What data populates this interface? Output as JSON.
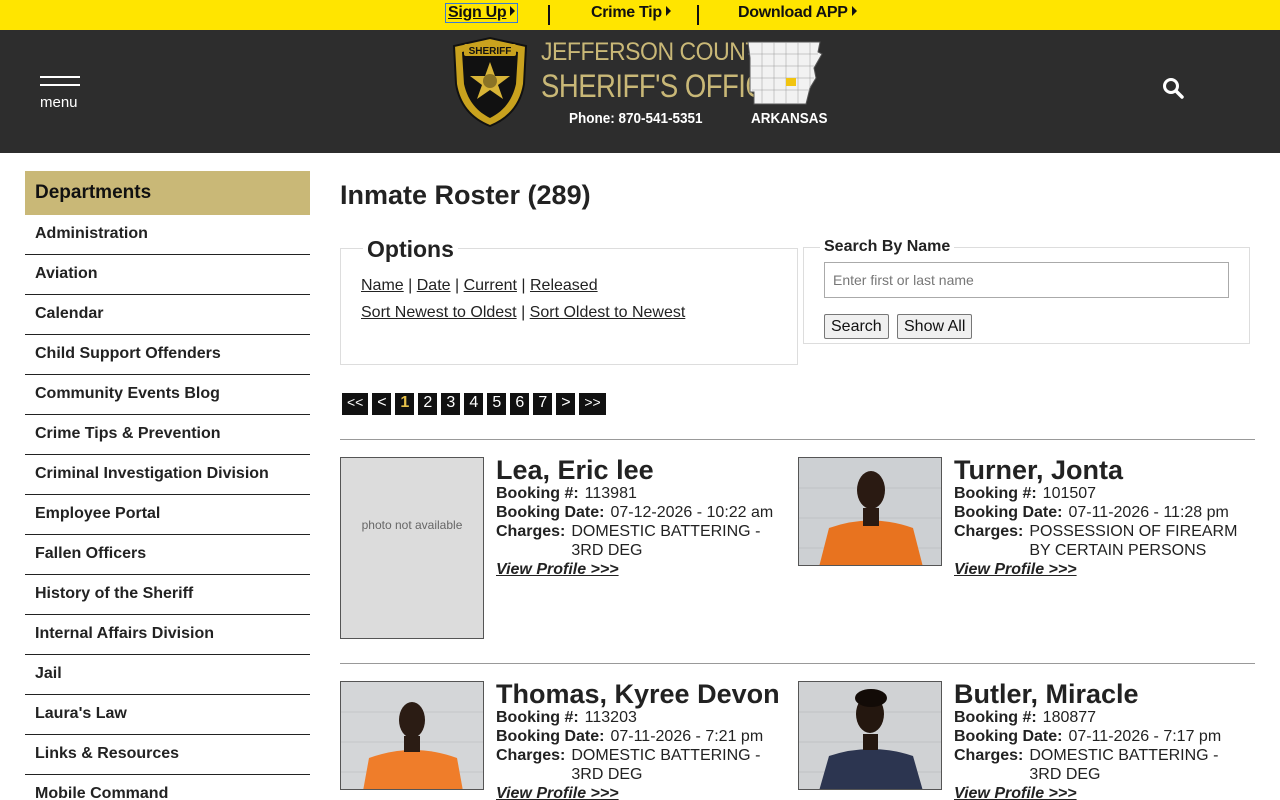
{
  "topbar": {
    "signup": "Sign Up",
    "crime_tip": "Crime Tip",
    "download_app": "Download APP"
  },
  "header": {
    "menu_label": "menu",
    "title_line1": "JEFFERSON COUNTY",
    "title_line2": "SHERIFF'S OFFICE",
    "phone": "Phone: 870-541-5351",
    "state": "ARKANSAS",
    "badge_text": "SHERIFF",
    "brand_gold": "#c9b877",
    "header_bg": "#2d2d2d",
    "topbar_bg": "#ffe500"
  },
  "sidebar": {
    "heading": "Departments",
    "items": [
      "Administration",
      "Aviation",
      "Calendar",
      "Child Support Offenders",
      "Community Events Blog",
      "Crime Tips & Prevention",
      "Criminal Investigation Division",
      "Employee Portal",
      "Fallen Officers",
      "History of the Sheriff",
      "Internal Affairs Division",
      "Jail",
      "Laura's Law",
      "Links & Resources",
      "Mobile Command"
    ]
  },
  "main": {
    "title": "Inmate Roster (289)",
    "options": {
      "legend": "Options",
      "sort_name": "Name",
      "sort_date": "Date",
      "filter_current": "Current",
      "filter_released": "Released",
      "sort_newest": "Sort Newest to Oldest",
      "sort_oldest": "Sort Oldest to Newest"
    },
    "search": {
      "legend": "Search By Name",
      "placeholder": "Enter first or last name",
      "search_label": "Search",
      "show_all_label": "Show All"
    },
    "pager": [
      "<<",
      "<",
      "1",
      "2",
      "3",
      "4",
      "5",
      "6",
      "7",
      ">",
      ">>"
    ],
    "current_page": "1",
    "labels": {
      "booking_no": "Booking #:",
      "booking_date": "Booking Date:",
      "charges": "Charges:",
      "view_profile": "View Profile >>>",
      "photo_na": "photo not available"
    },
    "inmates": [
      {
        "name": "Lea, Eric lee",
        "booking_no": "113981",
        "booking_date": "07-12-2026 - 10:22 am",
        "charges": "DOMESTIC BATTERING - 3RD DEG",
        "photo": "none"
      },
      {
        "name": "Turner, Jonta",
        "booking_no": "101507",
        "booking_date": "07-11-2026 - 11:28 pm",
        "charges": "POSSESSION OF FIREARM BY CERTAIN PERSONS",
        "photo": "orange"
      },
      {
        "name": "Thomas, Kyree Devon",
        "booking_no": "113203",
        "booking_date": "07-11-2026 - 7:21 pm",
        "charges": "DOMESTIC BATTERING - 3RD DEG",
        "photo": "orange"
      },
      {
        "name": "Butler, Miracle",
        "booking_no": "180877",
        "booking_date": "07-11-2026 - 7:17 pm",
        "charges": "DOMESTIC BATTERING - 3RD DEG",
        "photo": "navy"
      }
    ]
  }
}
